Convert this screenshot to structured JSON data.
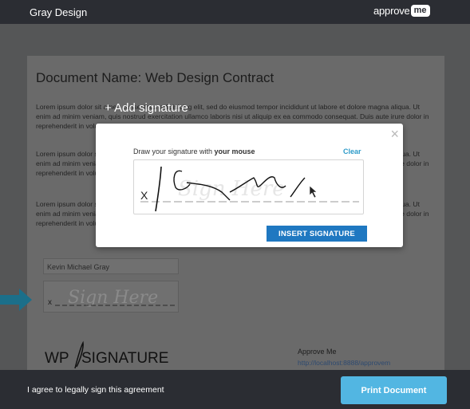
{
  "header": {
    "title": "Gray Design",
    "brand_word": "approve",
    "brand_badge": "me"
  },
  "document": {
    "title": "Document Name: Web Design Contract",
    "paragraph": "Lorem ipsum dolor sit amet, consectetur adipisicing elit, sed do eiusmod tempor incididunt ut labore et dolore magna aliqua. Ut enim ad minim veniam, quis nostrud exercitation ullamco laboris nisi ut aliquip ex ea commodo consequat. Duis aute irure dolor in reprehenderit in voluptate velit esse cillum dolore eu fugiat nulla pariatur. Excepteur sint occaecat cupidatat non proident.",
    "signer_name": "Kevin Michael Gray",
    "sign_placeholder": "Sign Here",
    "sign_x": "x",
    "approve_label": "Approve Me",
    "approve_link": "http://localhost:8888/approvem",
    "wp_logo_left": "WP",
    "wp_logo_right": "SIGNATURE"
  },
  "overlay": {
    "add_signature": "+ Add signature"
  },
  "modal": {
    "instruction_prefix": "Draw your signature with ",
    "instruction_bold": "your mouse",
    "clear_label": "Clear",
    "close_glyph": "×",
    "pad_x": "X",
    "pad_watermark": "Sign Here",
    "insert_label": "INSERT SIGNATURE"
  },
  "footer": {
    "agree_text": "I agree to legally sign this agreement",
    "print_label": "Print Document"
  },
  "colors": {
    "topbar": "#2b2d33",
    "insert_button": "#1f78c1",
    "print_button": "#52b6e2",
    "clear_link": "#2d9bc9",
    "arrow": "#1b6f8a"
  }
}
